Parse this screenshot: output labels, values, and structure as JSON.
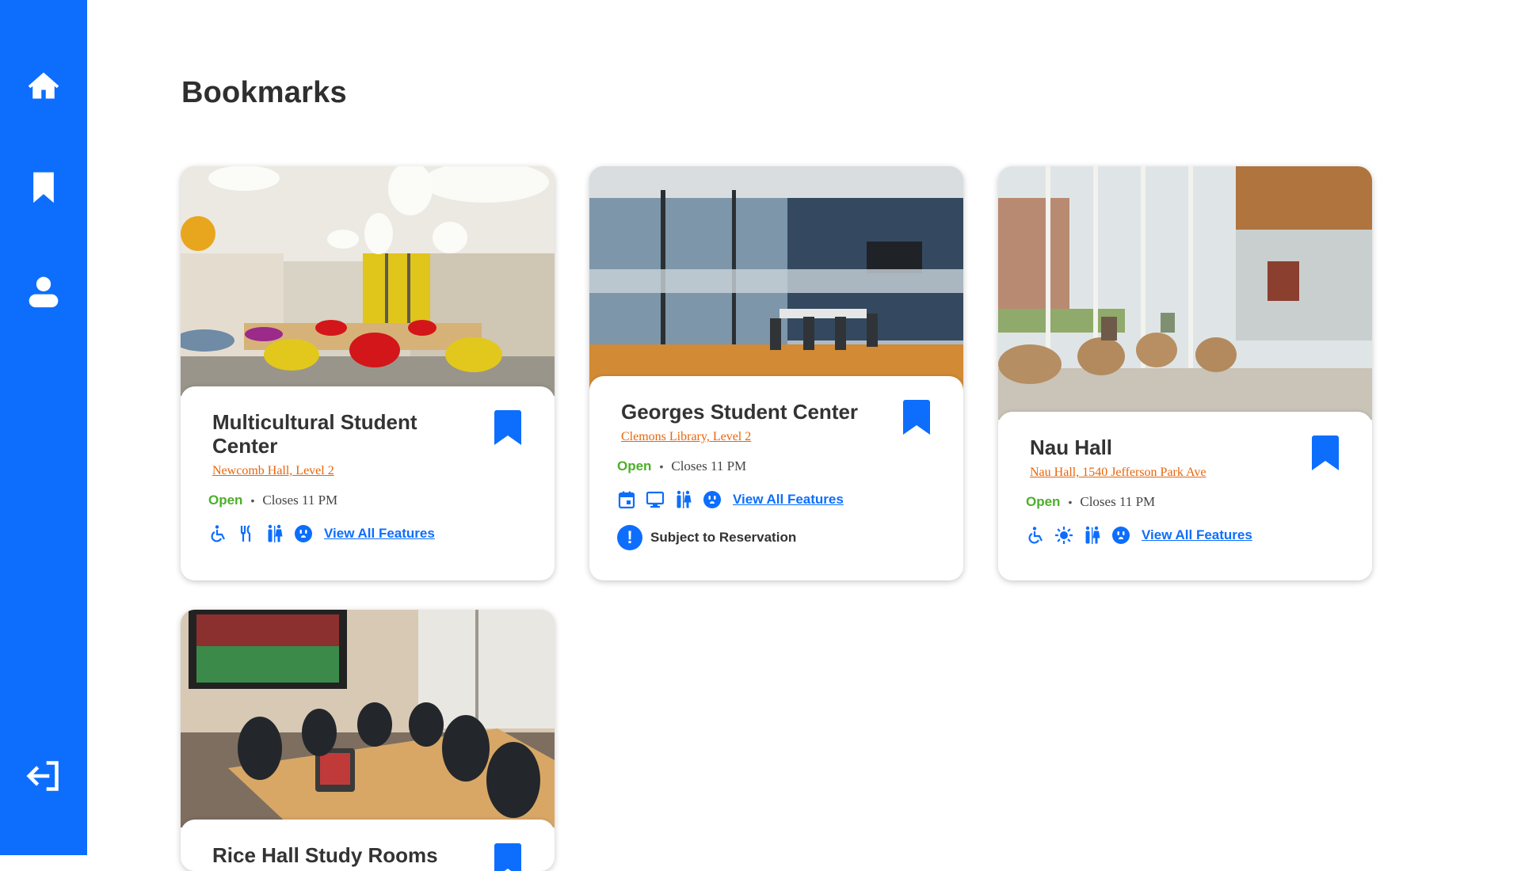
{
  "page": {
    "title": "Bookmarks"
  },
  "sidebar": {
    "items": [
      {
        "name": "home",
        "icon": "home-icon"
      },
      {
        "name": "bookmarks",
        "icon": "bookmark-icon"
      },
      {
        "name": "profile",
        "icon": "user-icon"
      },
      {
        "name": "logout",
        "icon": "logout-icon"
      }
    ]
  },
  "colors": {
    "accent": "#0d6efd",
    "location": "#e8650a",
    "open": "#4caf2a"
  },
  "cards": [
    {
      "title": "Multicultural Student Center",
      "location": "Newcomb Hall, Level 2",
      "status": "Open",
      "closes": "Closes 11 PM",
      "features": [
        "accessible-icon",
        "utensils-icon",
        "restroom-icon",
        "outlet-icon"
      ],
      "features_link": "View All Features"
    },
    {
      "title": "Georges Student Center",
      "location": "Clemons Library, Level 2",
      "status": "Open",
      "closes": "Closes 11 PM",
      "features": [
        "calendar-icon",
        "monitor-icon",
        "restroom-icon",
        "outlet-icon"
      ],
      "features_link": "View All Features",
      "notice": "Subject to Reservation"
    },
    {
      "title": "Nau Hall",
      "location": "Nau Hall, 1540 Jefferson Park Ave",
      "status": "Open",
      "closes": "Closes 11 PM",
      "features": [
        "accessible-icon",
        "sun-icon",
        "restroom-icon",
        "outlet-icon"
      ],
      "features_link": "View All Features"
    },
    {
      "title": "Rice Hall Study Rooms"
    }
  ]
}
